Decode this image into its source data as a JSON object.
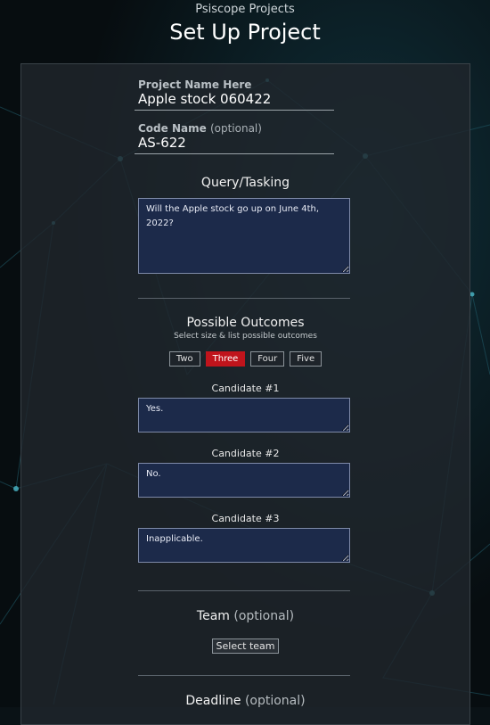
{
  "header": {
    "brand": "Psiscope Projects",
    "title": "Set Up Project"
  },
  "project_name": {
    "label": "Project Name Here",
    "value": "Apple stock 060422"
  },
  "code_name": {
    "label": "Code Name",
    "optional": "(optional)",
    "value": "AS-622"
  },
  "query": {
    "title": "Query/Tasking",
    "value": "Will the Apple stock go up on June 4th, 2022?"
  },
  "outcomes": {
    "title": "Possible Outcomes",
    "subtitle": "Select size & list possible outcomes",
    "sizes": [
      "Two",
      "Three",
      "Four",
      "Five"
    ],
    "selected": "Three",
    "candidates": [
      {
        "label": "Candidate #1",
        "value": "Yes."
      },
      {
        "label": "Candidate #2",
        "value": "No."
      },
      {
        "label": "Candidate #3",
        "value": "Inapplicable."
      }
    ]
  },
  "team": {
    "title": "Team",
    "optional": "(optional)",
    "button": "Select team"
  },
  "deadline": {
    "title": "Deadline",
    "optional": "(optional)"
  },
  "colors": {
    "accent": "#c0141c",
    "input_bg": "#1c2a4a"
  }
}
